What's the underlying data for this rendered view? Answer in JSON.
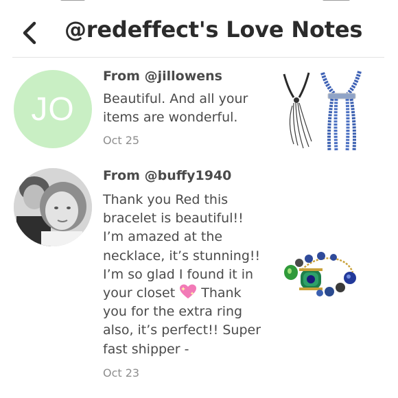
{
  "header": {
    "title": "@redeffect's Love Notes",
    "back_icon": "chevron-left-icon"
  },
  "notes": [
    {
      "from": "From @jillowens",
      "avatar_initials": "JO",
      "avatar_color": "#c9efc4",
      "text": "Beautiful. And all your items are wonderful.",
      "date": "Oct 25",
      "item_image": "necklaces-thumbnail"
    },
    {
      "from": "From @buffy1940",
      "avatar_image": "user-photo",
      "text_before_emoji": "Thank you Red this bracelet is beautiful!! I’m amazed at the necklace, it’s stunning!! I’m so glad I found it in your closet ",
      "emoji": "sparkling-heart-icon",
      "text_after_emoji": " Thank you for the extra ring also, it’s perfect!! Super fast shipper -",
      "date": "Oct 23",
      "item_image": "bracelet-thumbnail"
    }
  ]
}
